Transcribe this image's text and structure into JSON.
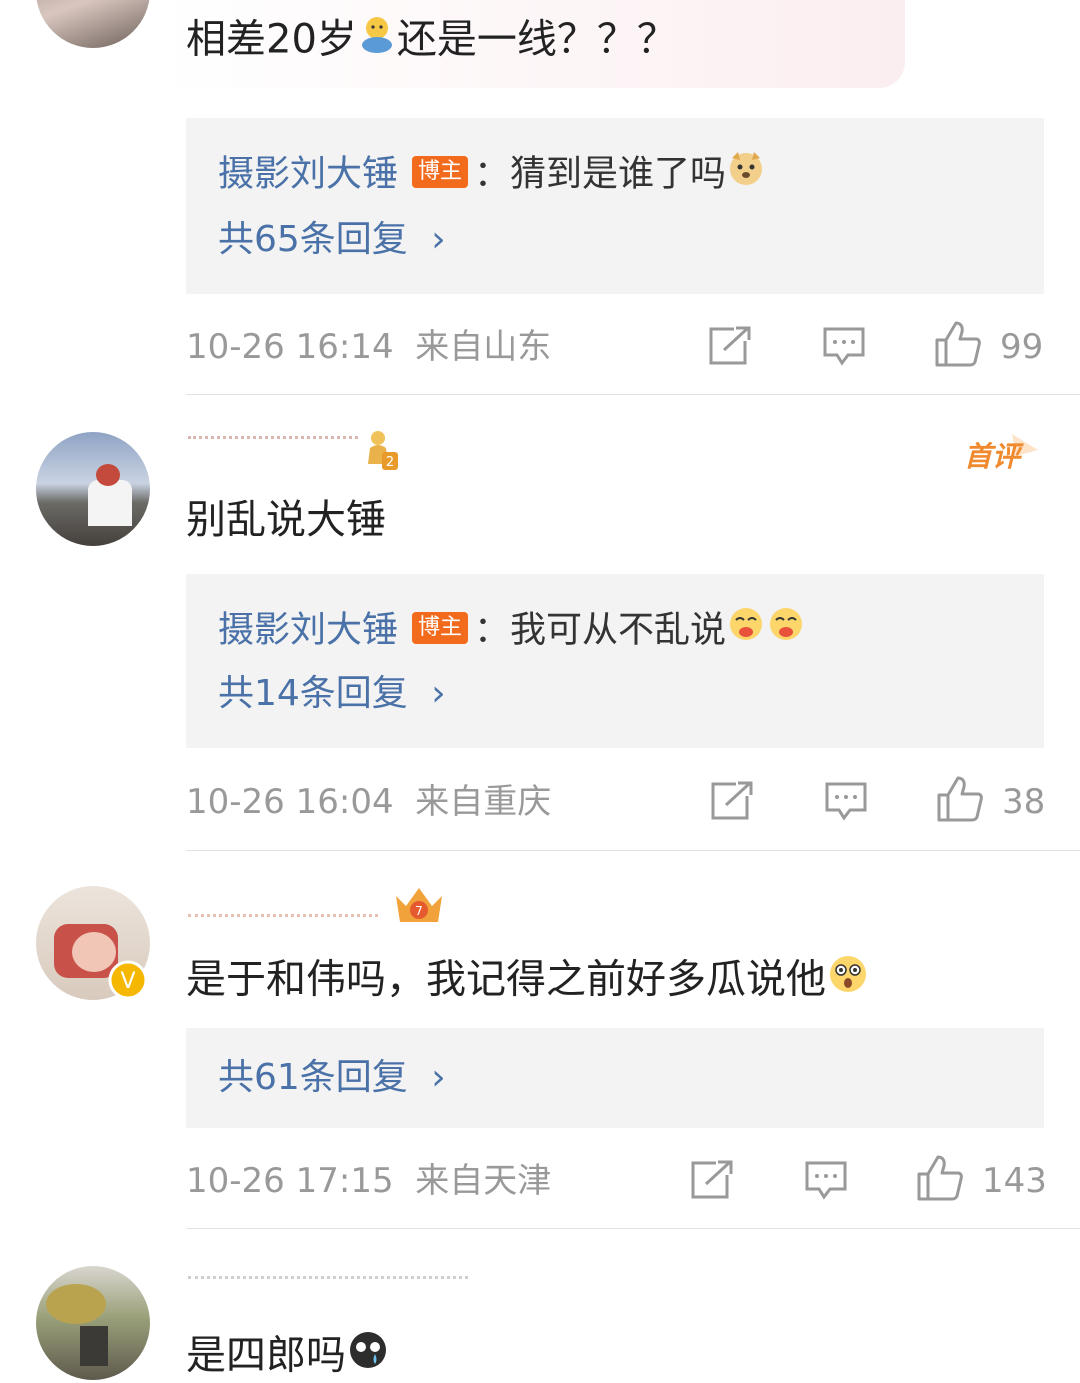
{
  "comments": [
    {
      "text": "相差20岁",
      "text_after": "还是一线？？？",
      "replies": [
        {
          "user": "摄影刘大锤",
          "badge": "博主",
          "text": "：猜到是谁了吗"
        }
      ],
      "more": "共65条回复",
      "time": "10-26 16:14",
      "location": "来自山东",
      "likes": "99"
    },
    {
      "tag": "首评",
      "text": "别乱说大锤",
      "replies": [
        {
          "user": "摄影刘大锤",
          "badge": "博主",
          "text": "：我可从不乱说"
        }
      ],
      "more": "共14条回复",
      "time": "10-26 16:04",
      "location": "来自重庆",
      "likes": "38"
    },
    {
      "text": "是于和伟吗，我记得之前好多瓜说他",
      "replies": [],
      "more": "共61条回复",
      "time": "10-26 17:15",
      "location": "来自天津",
      "likes": "143"
    },
    {
      "text": "是四郎吗"
    }
  ],
  "colors": {
    "link": "#4a72a8",
    "badge": "#f26b1d",
    "meta": "#999999",
    "reply_bg": "#f3f3f3"
  }
}
